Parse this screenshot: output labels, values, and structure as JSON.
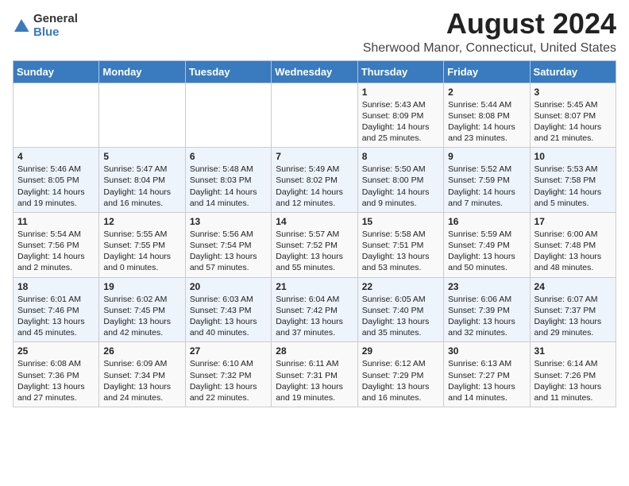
{
  "logo": {
    "general": "General",
    "blue": "Blue"
  },
  "title": "August 2024",
  "location": "Sherwood Manor, Connecticut, United States",
  "days_of_week": [
    "Sunday",
    "Monday",
    "Tuesday",
    "Wednesday",
    "Thursday",
    "Friday",
    "Saturday"
  ],
  "weeks": [
    [
      {
        "day": "",
        "info": ""
      },
      {
        "day": "",
        "info": ""
      },
      {
        "day": "",
        "info": ""
      },
      {
        "day": "",
        "info": ""
      },
      {
        "day": "1",
        "info": "Sunrise: 5:43 AM\nSunset: 8:09 PM\nDaylight: 14 hours\nand 25 minutes."
      },
      {
        "day": "2",
        "info": "Sunrise: 5:44 AM\nSunset: 8:08 PM\nDaylight: 14 hours\nand 23 minutes."
      },
      {
        "day": "3",
        "info": "Sunrise: 5:45 AM\nSunset: 8:07 PM\nDaylight: 14 hours\nand 21 minutes."
      }
    ],
    [
      {
        "day": "4",
        "info": "Sunrise: 5:46 AM\nSunset: 8:05 PM\nDaylight: 14 hours\nand 19 minutes."
      },
      {
        "day": "5",
        "info": "Sunrise: 5:47 AM\nSunset: 8:04 PM\nDaylight: 14 hours\nand 16 minutes."
      },
      {
        "day": "6",
        "info": "Sunrise: 5:48 AM\nSunset: 8:03 PM\nDaylight: 14 hours\nand 14 minutes."
      },
      {
        "day": "7",
        "info": "Sunrise: 5:49 AM\nSunset: 8:02 PM\nDaylight: 14 hours\nand 12 minutes."
      },
      {
        "day": "8",
        "info": "Sunrise: 5:50 AM\nSunset: 8:00 PM\nDaylight: 14 hours\nand 9 minutes."
      },
      {
        "day": "9",
        "info": "Sunrise: 5:52 AM\nSunset: 7:59 PM\nDaylight: 14 hours\nand 7 minutes."
      },
      {
        "day": "10",
        "info": "Sunrise: 5:53 AM\nSunset: 7:58 PM\nDaylight: 14 hours\nand 5 minutes."
      }
    ],
    [
      {
        "day": "11",
        "info": "Sunrise: 5:54 AM\nSunset: 7:56 PM\nDaylight: 14 hours\nand 2 minutes."
      },
      {
        "day": "12",
        "info": "Sunrise: 5:55 AM\nSunset: 7:55 PM\nDaylight: 14 hours\nand 0 minutes."
      },
      {
        "day": "13",
        "info": "Sunrise: 5:56 AM\nSunset: 7:54 PM\nDaylight: 13 hours\nand 57 minutes."
      },
      {
        "day": "14",
        "info": "Sunrise: 5:57 AM\nSunset: 7:52 PM\nDaylight: 13 hours\nand 55 minutes."
      },
      {
        "day": "15",
        "info": "Sunrise: 5:58 AM\nSunset: 7:51 PM\nDaylight: 13 hours\nand 53 minutes."
      },
      {
        "day": "16",
        "info": "Sunrise: 5:59 AM\nSunset: 7:49 PM\nDaylight: 13 hours\nand 50 minutes."
      },
      {
        "day": "17",
        "info": "Sunrise: 6:00 AM\nSunset: 7:48 PM\nDaylight: 13 hours\nand 48 minutes."
      }
    ],
    [
      {
        "day": "18",
        "info": "Sunrise: 6:01 AM\nSunset: 7:46 PM\nDaylight: 13 hours\nand 45 minutes."
      },
      {
        "day": "19",
        "info": "Sunrise: 6:02 AM\nSunset: 7:45 PM\nDaylight: 13 hours\nand 42 minutes."
      },
      {
        "day": "20",
        "info": "Sunrise: 6:03 AM\nSunset: 7:43 PM\nDaylight: 13 hours\nand 40 minutes."
      },
      {
        "day": "21",
        "info": "Sunrise: 6:04 AM\nSunset: 7:42 PM\nDaylight: 13 hours\nand 37 minutes."
      },
      {
        "day": "22",
        "info": "Sunrise: 6:05 AM\nSunset: 7:40 PM\nDaylight: 13 hours\nand 35 minutes."
      },
      {
        "day": "23",
        "info": "Sunrise: 6:06 AM\nSunset: 7:39 PM\nDaylight: 13 hours\nand 32 minutes."
      },
      {
        "day": "24",
        "info": "Sunrise: 6:07 AM\nSunset: 7:37 PM\nDaylight: 13 hours\nand 29 minutes."
      }
    ],
    [
      {
        "day": "25",
        "info": "Sunrise: 6:08 AM\nSunset: 7:36 PM\nDaylight: 13 hours\nand 27 minutes."
      },
      {
        "day": "26",
        "info": "Sunrise: 6:09 AM\nSunset: 7:34 PM\nDaylight: 13 hours\nand 24 minutes."
      },
      {
        "day": "27",
        "info": "Sunrise: 6:10 AM\nSunset: 7:32 PM\nDaylight: 13 hours\nand 22 minutes."
      },
      {
        "day": "28",
        "info": "Sunrise: 6:11 AM\nSunset: 7:31 PM\nDaylight: 13 hours\nand 19 minutes."
      },
      {
        "day": "29",
        "info": "Sunrise: 6:12 AM\nSunset: 7:29 PM\nDaylight: 13 hours\nand 16 minutes."
      },
      {
        "day": "30",
        "info": "Sunrise: 6:13 AM\nSunset: 7:27 PM\nDaylight: 13 hours\nand 14 minutes."
      },
      {
        "day": "31",
        "info": "Sunrise: 6:14 AM\nSunset: 7:26 PM\nDaylight: 13 hours\nand 11 minutes."
      }
    ]
  ]
}
